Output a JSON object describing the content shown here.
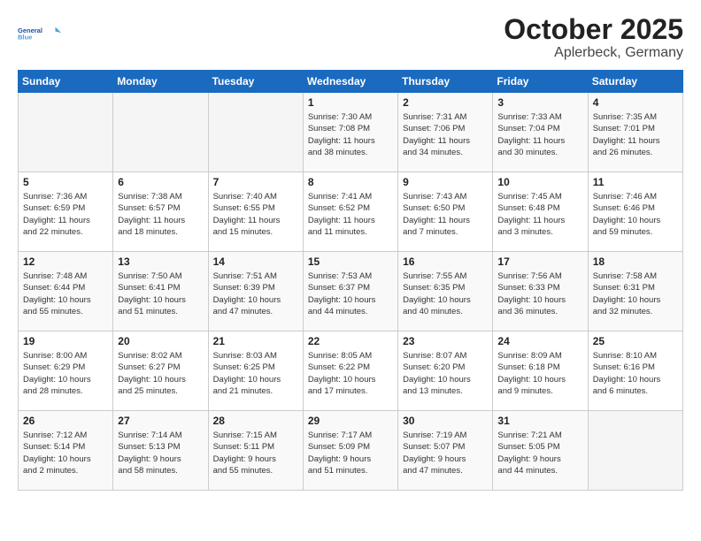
{
  "header": {
    "logo_line1": "General",
    "logo_line2": "Blue",
    "title": "October 2025",
    "subtitle": "Aplerbeck, Germany"
  },
  "days_of_week": [
    "Sunday",
    "Monday",
    "Tuesday",
    "Wednesday",
    "Thursday",
    "Friday",
    "Saturday"
  ],
  "weeks": [
    [
      {
        "num": "",
        "info": ""
      },
      {
        "num": "",
        "info": ""
      },
      {
        "num": "",
        "info": ""
      },
      {
        "num": "1",
        "info": "Sunrise: 7:30 AM\nSunset: 7:08 PM\nDaylight: 11 hours\nand 38 minutes."
      },
      {
        "num": "2",
        "info": "Sunrise: 7:31 AM\nSunset: 7:06 PM\nDaylight: 11 hours\nand 34 minutes."
      },
      {
        "num": "3",
        "info": "Sunrise: 7:33 AM\nSunset: 7:04 PM\nDaylight: 11 hours\nand 30 minutes."
      },
      {
        "num": "4",
        "info": "Sunrise: 7:35 AM\nSunset: 7:01 PM\nDaylight: 11 hours\nand 26 minutes."
      }
    ],
    [
      {
        "num": "5",
        "info": "Sunrise: 7:36 AM\nSunset: 6:59 PM\nDaylight: 11 hours\nand 22 minutes."
      },
      {
        "num": "6",
        "info": "Sunrise: 7:38 AM\nSunset: 6:57 PM\nDaylight: 11 hours\nand 18 minutes."
      },
      {
        "num": "7",
        "info": "Sunrise: 7:40 AM\nSunset: 6:55 PM\nDaylight: 11 hours\nand 15 minutes."
      },
      {
        "num": "8",
        "info": "Sunrise: 7:41 AM\nSunset: 6:52 PM\nDaylight: 11 hours\nand 11 minutes."
      },
      {
        "num": "9",
        "info": "Sunrise: 7:43 AM\nSunset: 6:50 PM\nDaylight: 11 hours\nand 7 minutes."
      },
      {
        "num": "10",
        "info": "Sunrise: 7:45 AM\nSunset: 6:48 PM\nDaylight: 11 hours\nand 3 minutes."
      },
      {
        "num": "11",
        "info": "Sunrise: 7:46 AM\nSunset: 6:46 PM\nDaylight: 10 hours\nand 59 minutes."
      }
    ],
    [
      {
        "num": "12",
        "info": "Sunrise: 7:48 AM\nSunset: 6:44 PM\nDaylight: 10 hours\nand 55 minutes."
      },
      {
        "num": "13",
        "info": "Sunrise: 7:50 AM\nSunset: 6:41 PM\nDaylight: 10 hours\nand 51 minutes."
      },
      {
        "num": "14",
        "info": "Sunrise: 7:51 AM\nSunset: 6:39 PM\nDaylight: 10 hours\nand 47 minutes."
      },
      {
        "num": "15",
        "info": "Sunrise: 7:53 AM\nSunset: 6:37 PM\nDaylight: 10 hours\nand 44 minutes."
      },
      {
        "num": "16",
        "info": "Sunrise: 7:55 AM\nSunset: 6:35 PM\nDaylight: 10 hours\nand 40 minutes."
      },
      {
        "num": "17",
        "info": "Sunrise: 7:56 AM\nSunset: 6:33 PM\nDaylight: 10 hours\nand 36 minutes."
      },
      {
        "num": "18",
        "info": "Sunrise: 7:58 AM\nSunset: 6:31 PM\nDaylight: 10 hours\nand 32 minutes."
      }
    ],
    [
      {
        "num": "19",
        "info": "Sunrise: 8:00 AM\nSunset: 6:29 PM\nDaylight: 10 hours\nand 28 minutes."
      },
      {
        "num": "20",
        "info": "Sunrise: 8:02 AM\nSunset: 6:27 PM\nDaylight: 10 hours\nand 25 minutes."
      },
      {
        "num": "21",
        "info": "Sunrise: 8:03 AM\nSunset: 6:25 PM\nDaylight: 10 hours\nand 21 minutes."
      },
      {
        "num": "22",
        "info": "Sunrise: 8:05 AM\nSunset: 6:22 PM\nDaylight: 10 hours\nand 17 minutes."
      },
      {
        "num": "23",
        "info": "Sunrise: 8:07 AM\nSunset: 6:20 PM\nDaylight: 10 hours\nand 13 minutes."
      },
      {
        "num": "24",
        "info": "Sunrise: 8:09 AM\nSunset: 6:18 PM\nDaylight: 10 hours\nand 9 minutes."
      },
      {
        "num": "25",
        "info": "Sunrise: 8:10 AM\nSunset: 6:16 PM\nDaylight: 10 hours\nand 6 minutes."
      }
    ],
    [
      {
        "num": "26",
        "info": "Sunrise: 7:12 AM\nSunset: 5:14 PM\nDaylight: 10 hours\nand 2 minutes."
      },
      {
        "num": "27",
        "info": "Sunrise: 7:14 AM\nSunset: 5:13 PM\nDaylight: 9 hours\nand 58 minutes."
      },
      {
        "num": "28",
        "info": "Sunrise: 7:15 AM\nSunset: 5:11 PM\nDaylight: 9 hours\nand 55 minutes."
      },
      {
        "num": "29",
        "info": "Sunrise: 7:17 AM\nSunset: 5:09 PM\nDaylight: 9 hours\nand 51 minutes."
      },
      {
        "num": "30",
        "info": "Sunrise: 7:19 AM\nSunset: 5:07 PM\nDaylight: 9 hours\nand 47 minutes."
      },
      {
        "num": "31",
        "info": "Sunrise: 7:21 AM\nSunset: 5:05 PM\nDaylight: 9 hours\nand 44 minutes."
      },
      {
        "num": "",
        "info": ""
      }
    ]
  ]
}
